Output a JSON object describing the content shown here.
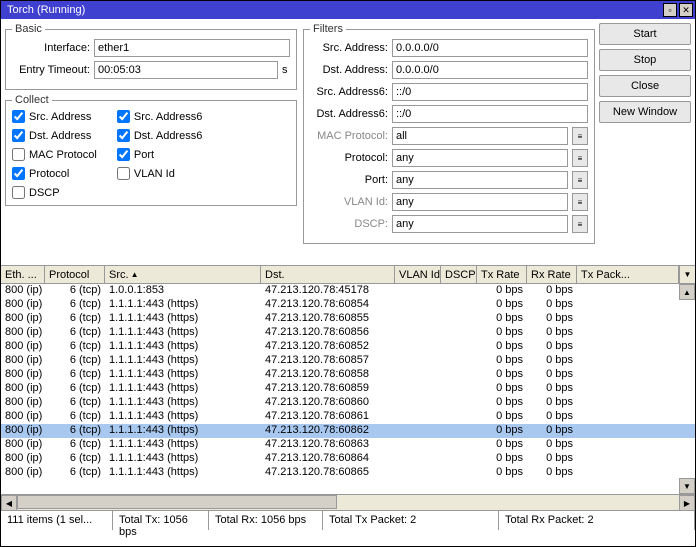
{
  "title": "Torch (Running)",
  "buttons": {
    "start": "Start",
    "stop": "Stop",
    "close": "Close",
    "new_window": "New Window"
  },
  "basic": {
    "legend": "Basic",
    "interface_label": "Interface:",
    "interface_value": "ether1",
    "timeout_label": "Entry Timeout:",
    "timeout_value": "00:05:03",
    "timeout_unit": "s"
  },
  "collect": {
    "legend": "Collect",
    "items": [
      {
        "label": "Src. Address",
        "checked": true
      },
      {
        "label": "Dst. Address",
        "checked": true
      },
      {
        "label": "MAC Protocol",
        "checked": false
      },
      {
        "label": "Protocol",
        "checked": true
      },
      {
        "label": "DSCP",
        "checked": false
      },
      {
        "label": "Src. Address6",
        "checked": true
      },
      {
        "label": "Dst. Address6",
        "checked": true
      },
      {
        "label": "Port",
        "checked": true
      },
      {
        "label": "VLAN Id",
        "checked": false
      }
    ]
  },
  "filters": {
    "legend": "Filters",
    "rows": [
      {
        "label": "Src. Address:",
        "value": "0.0.0.0/0",
        "dim": false,
        "combo": false
      },
      {
        "label": "Dst. Address:",
        "value": "0.0.0.0/0",
        "dim": false,
        "combo": false
      },
      {
        "label": "Src. Address6:",
        "value": "::/0",
        "dim": false,
        "combo": false
      },
      {
        "label": "Dst. Address6:",
        "value": "::/0",
        "dim": false,
        "combo": false
      },
      {
        "label": "MAC Protocol:",
        "value": "all",
        "dim": true,
        "combo": true
      },
      {
        "label": "Protocol:",
        "value": "any",
        "dim": false,
        "combo": true
      },
      {
        "label": "Port:",
        "value": "any",
        "dim": false,
        "combo": true
      },
      {
        "label": "VLAN Id:",
        "value": "any",
        "dim": true,
        "combo": true
      },
      {
        "label": "DSCP:",
        "value": "any",
        "dim": true,
        "combo": true
      }
    ]
  },
  "columns": [
    "Eth. ...",
    "Protocol",
    "Src.",
    "Dst.",
    "VLAN Id",
    "DSCP",
    "Tx Rate",
    "Rx Rate",
    "Tx Pack..."
  ],
  "rows": [
    {
      "eth": "800 (ip)",
      "proto": "6 (tcp)",
      "src": "1.0.0.1:853",
      "dst": "47.213.120.78:45178",
      "tx": "0 bps",
      "rx": "0 bps",
      "sel": false
    },
    {
      "eth": "800 (ip)",
      "proto": "6 (tcp)",
      "src": "1.1.1.1:443 (https)",
      "dst": "47.213.120.78:60854",
      "tx": "0 bps",
      "rx": "0 bps",
      "sel": false
    },
    {
      "eth": "800 (ip)",
      "proto": "6 (tcp)",
      "src": "1.1.1.1:443 (https)",
      "dst": "47.213.120.78:60855",
      "tx": "0 bps",
      "rx": "0 bps",
      "sel": false
    },
    {
      "eth": "800 (ip)",
      "proto": "6 (tcp)",
      "src": "1.1.1.1:443 (https)",
      "dst": "47.213.120.78:60856",
      "tx": "0 bps",
      "rx": "0 bps",
      "sel": false
    },
    {
      "eth": "800 (ip)",
      "proto": "6 (tcp)",
      "src": "1.1.1.1:443 (https)",
      "dst": "47.213.120.78:60852",
      "tx": "0 bps",
      "rx": "0 bps",
      "sel": false
    },
    {
      "eth": "800 (ip)",
      "proto": "6 (tcp)",
      "src": "1.1.1.1:443 (https)",
      "dst": "47.213.120.78:60857",
      "tx": "0 bps",
      "rx": "0 bps",
      "sel": false
    },
    {
      "eth": "800 (ip)",
      "proto": "6 (tcp)",
      "src": "1.1.1.1:443 (https)",
      "dst": "47.213.120.78:60858",
      "tx": "0 bps",
      "rx": "0 bps",
      "sel": false
    },
    {
      "eth": "800 (ip)",
      "proto": "6 (tcp)",
      "src": "1.1.1.1:443 (https)",
      "dst": "47.213.120.78:60859",
      "tx": "0 bps",
      "rx": "0 bps",
      "sel": false
    },
    {
      "eth": "800 (ip)",
      "proto": "6 (tcp)",
      "src": "1.1.1.1:443 (https)",
      "dst": "47.213.120.78:60860",
      "tx": "0 bps",
      "rx": "0 bps",
      "sel": false
    },
    {
      "eth": "800 (ip)",
      "proto": "6 (tcp)",
      "src": "1.1.1.1:443 (https)",
      "dst": "47.213.120.78:60861",
      "tx": "0 bps",
      "rx": "0 bps",
      "sel": false
    },
    {
      "eth": "800 (ip)",
      "proto": "6 (tcp)",
      "src": "1.1.1.1:443 (https)",
      "dst": "47.213.120.78:60862",
      "tx": "0 bps",
      "rx": "0 bps",
      "sel": true
    },
    {
      "eth": "800 (ip)",
      "proto": "6 (tcp)",
      "src": "1.1.1.1:443 (https)",
      "dst": "47.213.120.78:60863",
      "tx": "0 bps",
      "rx": "0 bps",
      "sel": false
    },
    {
      "eth": "800 (ip)",
      "proto": "6 (tcp)",
      "src": "1.1.1.1:443 (https)",
      "dst": "47.213.120.78:60864",
      "tx": "0 bps",
      "rx": "0 bps",
      "sel": false
    },
    {
      "eth": "800 (ip)",
      "proto": "6 (tcp)",
      "src": "1.1.1.1:443 (https)",
      "dst": "47.213.120.78:60865",
      "tx": "0 bps",
      "rx": "0 bps",
      "sel": false
    }
  ],
  "status": {
    "items": "111 items (1 sel...",
    "total_tx": "Total Tx: 1056 bps",
    "total_rx": "Total Rx: 1056 bps",
    "total_tx_packet": "Total Tx Packet: 2",
    "total_rx_packet": "Total Rx Packet: 2"
  }
}
